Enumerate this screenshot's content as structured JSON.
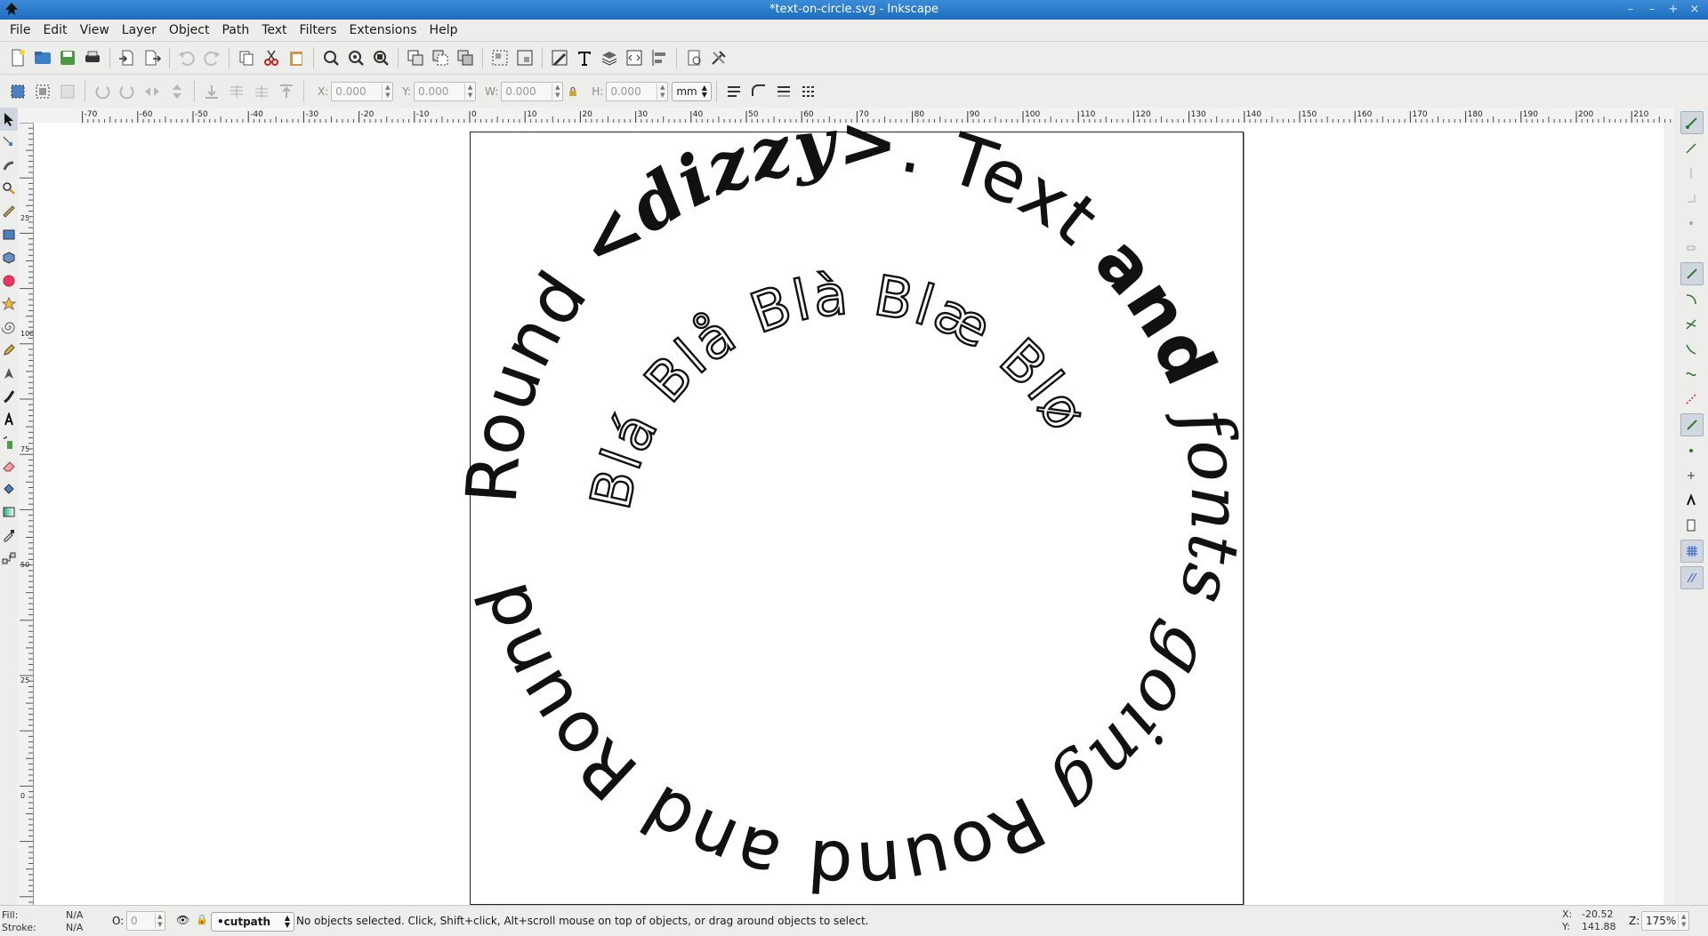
{
  "window": {
    "title": "*text-on-circle.svg - Inkscape",
    "controls": [
      "–",
      "–",
      "+",
      "×"
    ]
  },
  "menu": [
    "File",
    "Edit",
    "View",
    "Layer",
    "Object",
    "Path",
    "Text",
    "Filters",
    "Extensions",
    "Help"
  ],
  "controls": {
    "x_label": "X:",
    "x_value": "0.000",
    "y_label": "Y:",
    "y_value": "0.000",
    "w_label": "W:",
    "w_value": "0.000",
    "h_label": "H:",
    "h_value": "0.000",
    "unit": "mm"
  },
  "ruler": {
    "h_labels": [
      "-70",
      "-60",
      "-50",
      "-40",
      "-30",
      "-20",
      "-10",
      "0",
      "10",
      "20",
      "30",
      "40",
      "50",
      "60",
      "70",
      "80",
      "90",
      "100",
      "110",
      "120",
      "130",
      "140",
      "150",
      "160",
      "170",
      "180",
      "190",
      "200",
      "210"
    ],
    "v_labels": [
      "25",
      "100",
      "75",
      "50",
      "25",
      "0"
    ]
  },
  "artwork": {
    "outer_text": "<dizzy>. Text and fonts going Round and Round",
    "outer_parts": [
      "Round ",
      "<dizzy>",
      ". ",
      "Text ",
      "and ",
      "fonts ",
      "going ",
      "Round and Round"
    ],
    "inner_text": "Blá Blå Blà Blæ Blø"
  },
  "status": {
    "fill_label": "Fill:",
    "fill_value": "N/A",
    "stroke_label": "Stroke:",
    "stroke_value": "N/A",
    "opacity_label": "O:",
    "opacity_value": "0",
    "layer": "•cutpath",
    "message": "No objects selected. Click, Shift+click, Alt+scroll mouse on top of objects, or drag around objects to select.",
    "cursor_x_label": "X:",
    "cursor_x": "-20.52",
    "cursor_y_label": "Y:",
    "cursor_y": "141.88",
    "zoom_label": "Z:",
    "zoom": "175%"
  }
}
